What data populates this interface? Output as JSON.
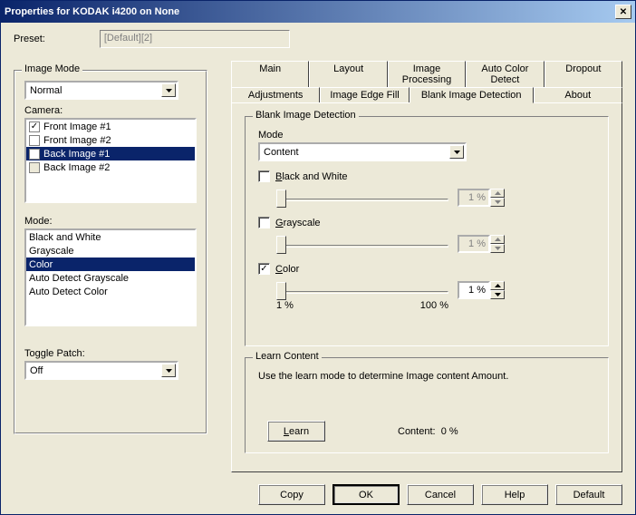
{
  "window": {
    "title": "Properties for KODAK i4200 on None"
  },
  "preset": {
    "label": "Preset:",
    "value": "[Default][2]"
  },
  "imageModeGroup": {
    "title": "Image Mode",
    "combo_value": "Normal",
    "cameraLabel": "Camera:",
    "cameraItems": [
      {
        "label": "Front Image #1",
        "checked": true,
        "selected": false
      },
      {
        "label": "Front Image #2",
        "checked": false,
        "selected": false
      },
      {
        "label": "Back Image #1",
        "checked": false,
        "selected": true
      },
      {
        "label": "Back Image #2",
        "checked": false,
        "selected": false,
        "dim": true
      }
    ],
    "modeLabel": "Mode:",
    "modeItems": [
      {
        "label": "Black and White",
        "selected": false
      },
      {
        "label": "Grayscale",
        "selected": false
      },
      {
        "label": "Color",
        "selected": true
      },
      {
        "label": "Auto Detect Grayscale",
        "selected": false
      },
      {
        "label": "Auto Detect Color",
        "selected": false
      }
    ],
    "toggleLabel": "Toggle Patch:",
    "toggle_value": "Off"
  },
  "tabs": {
    "row1": [
      "Main",
      "Layout",
      "Image Processing",
      "Auto Color Detect",
      "Dropout"
    ],
    "row2": [
      "Adjustments",
      "Image Edge Fill",
      "Blank Image Detection",
      "About"
    ],
    "active": "Blank Image Detection"
  },
  "bid": {
    "groupTitle": "Blank Image Detection",
    "modeLabel": "Mode",
    "modeValue": "Content",
    "bw": {
      "label_pre": "B",
      "label_rest": "lack and White",
      "checked": false,
      "value": "1 %",
      "thumb_pct": 0
    },
    "gs": {
      "label_pre": "G",
      "label_rest": "rayscale",
      "checked": false,
      "value": "1 %",
      "thumb_pct": 0
    },
    "color": {
      "label_pre": "C",
      "label_rest": "olor",
      "checked": true,
      "value": "1 %",
      "thumb_pct": 0
    },
    "ticks": {
      "min": "1 %",
      "max": "100 %"
    }
  },
  "learn": {
    "groupTitle": "Learn Content",
    "text": "Use the learn mode to determine Image content Amount.",
    "button": "Learn",
    "button_u": "L",
    "contentLabel": "Content:",
    "contentValue": "0 %"
  },
  "buttons": {
    "copy": "Copy",
    "ok": "OK",
    "cancel": "Cancel",
    "help": "Help",
    "default": "Default"
  }
}
